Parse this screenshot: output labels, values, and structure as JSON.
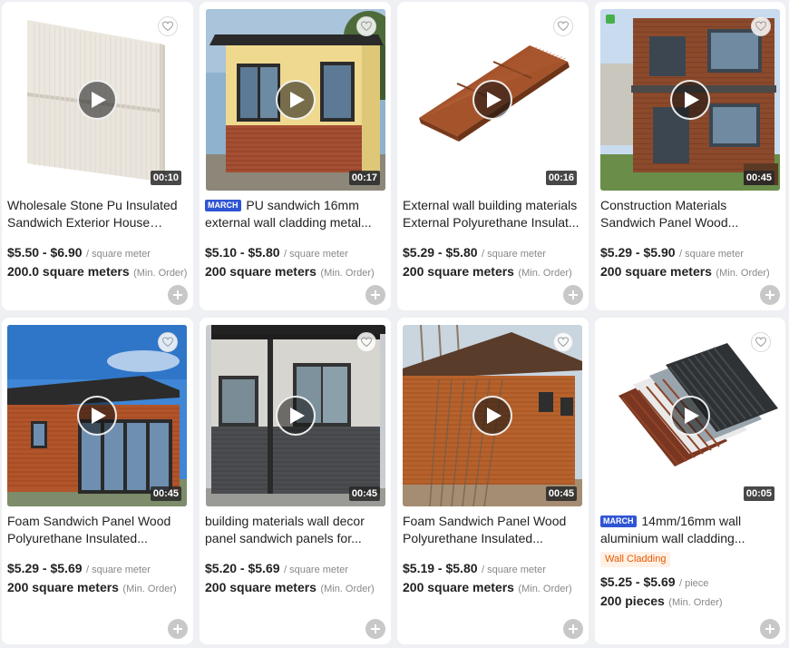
{
  "colors": {
    "badge_blue": "#2f55d4",
    "tag_orange": "#e85a00",
    "tag_bg": "#fff1e6"
  },
  "icons": {
    "favorite": "heart-outline-icon",
    "play": "play-icon",
    "add": "plus-circle-icon"
  },
  "products": [
    {
      "title": "Wholesale Stone Pu Insulated Sandwich Exterior House Wall...",
      "badge": "",
      "tag": "",
      "duration": "00:10",
      "price": "$5.50 - $6.90",
      "unit": "/ square meter",
      "moq": "200.0 square meters",
      "moq_label": "(Min. Order)",
      "art": "panel-beige"
    },
    {
      "title": "PU sandwich 16mm external wall cladding metal...",
      "badge": "MARCH",
      "tag": "",
      "duration": "00:17",
      "price": "$5.10 - $5.80",
      "unit": "/ square meter",
      "moq": "200 square meters",
      "moq_label": "(Min. Order)",
      "art": "booth"
    },
    {
      "title": "External wall building materials External Polyurethane Insulat...",
      "badge": "",
      "tag": "",
      "duration": "00:16",
      "price": "$5.29 - $5.80",
      "unit": "/ square meter",
      "moq": "200 square meters",
      "moq_label": "(Min. Order)",
      "art": "panel-wood"
    },
    {
      "title": "Construction Materials Sandwich Panel Wood...",
      "badge": "",
      "tag": "",
      "duration": "00:45",
      "price": "$5.29 - $5.90",
      "unit": "/ square meter",
      "moq": "200 square meters",
      "moq_label": "(Min. Order)",
      "art": "house"
    },
    {
      "title": "Foam Sandwich Panel Wood Polyurethane Insulated...",
      "badge": "",
      "tag": "",
      "duration": "00:45",
      "price": "$5.29 - $5.69",
      "unit": "/ square meter",
      "moq": "200 square meters",
      "moq_label": "(Min. Order)",
      "art": "cabin-wood"
    },
    {
      "title": "building materials wall decor panel sandwich panels for...",
      "badge": "",
      "tag": "",
      "duration": "00:45",
      "price": "$5.20 - $5.69",
      "unit": "/ square meter",
      "moq": "200 square meters",
      "moq_label": "(Min. Order)",
      "art": "cabin-grey"
    },
    {
      "title": "Foam Sandwich Panel Wood Polyurethane Insulated...",
      "badge": "",
      "tag": "",
      "duration": "00:45",
      "price": "$5.19 - $5.80",
      "unit": "/ square meter",
      "moq": "200 square meters",
      "moq_label": "(Min. Order)",
      "art": "shed"
    },
    {
      "title": "14mm/16mm wall aluminium wall cladding...",
      "badge": "MARCH",
      "tag": "Wall Cladding",
      "duration": "00:05",
      "price": "$5.25 - $5.69",
      "unit": "/ piece",
      "moq": "200 pieces",
      "moq_label": "(Min. Order)",
      "art": "layers"
    }
  ]
}
